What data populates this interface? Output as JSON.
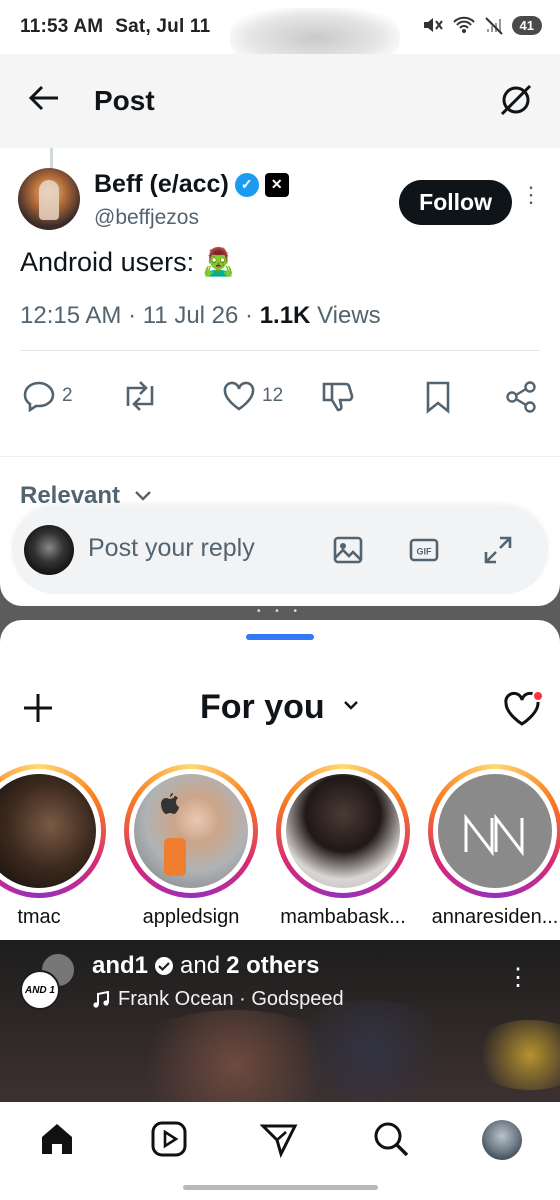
{
  "status_bar": {
    "time": "11:53 AM",
    "date": "Sat, Jul 11",
    "battery": "41"
  },
  "x_post": {
    "header_title": "Post",
    "author_name": "Beff (e/acc)",
    "author_handle": "@beffjezos",
    "follow_label": "Follow",
    "text": "Android users: 🧟‍♂️",
    "time": "12:15 AM",
    "date": "11 Jul 26",
    "views_count": "1.1K",
    "views_label": "Views",
    "replies_count": "2",
    "likes_count": "12",
    "sort_label": "Relevant",
    "reply_placeholder": "Post your reply",
    "gif_label": "GIF"
  },
  "instagram": {
    "feed_title": "For you",
    "stories": [
      {
        "username": "tmac"
      },
      {
        "username": "appledsign"
      },
      {
        "username": "mambabask..."
      },
      {
        "username": "annaresiden..."
      }
    ],
    "reel": {
      "avatar_text": "AND 1",
      "user": "and1",
      "and_text": "and",
      "others_text": "2 others",
      "music": "Frank Ocean · Godspeed"
    }
  },
  "colors": {
    "x_blue": "#1d9bf0",
    "ig_notification": "#ff3040",
    "pane_handle": "#3478f6"
  }
}
